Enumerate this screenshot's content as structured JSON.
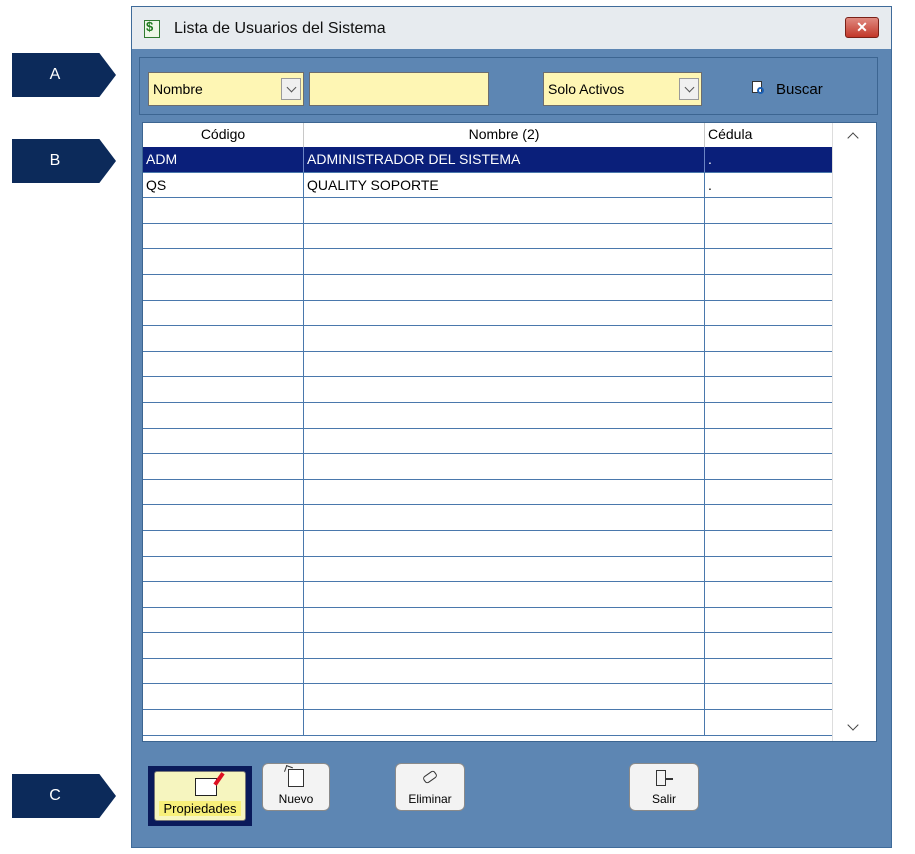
{
  "callouts": [
    "A",
    "B",
    "C"
  ],
  "window": {
    "title": "Lista de Usuarios del Sistema",
    "close_label": "✕"
  },
  "toolbar": {
    "field_selected": "Nombre",
    "search_value": "",
    "status_selected": "Solo Activos",
    "search_button": "Buscar"
  },
  "grid": {
    "columns": [
      "Código",
      "Nombre (2)",
      "Cédula"
    ],
    "rows": [
      {
        "codigo": "ADM",
        "nombre": "ADMINISTRADOR DEL SISTEMA",
        "cedula": ".",
        "selected": true
      },
      {
        "codigo": "QS",
        "nombre": "QUALITY SOPORTE",
        "cedula": ".",
        "selected": false
      }
    ]
  },
  "buttons": {
    "properties": "Propiedades",
    "new": "Nuevo",
    "delete": "Eliminar",
    "exit": "Salir"
  },
  "colors": {
    "window_bg": "#5d86b3",
    "input_bg": "#fef6b4",
    "selection": "#0a1f7a",
    "callout": "#0c2a5a"
  }
}
